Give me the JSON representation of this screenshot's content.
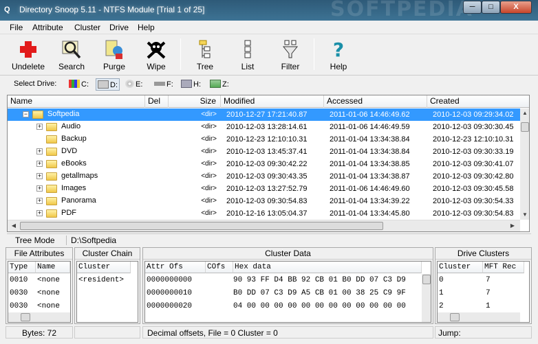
{
  "window": {
    "title": "Directory Snoop 5.11 - NTFS Module  [Trial 1 of 25]",
    "watermark": "SOFTPEDIA",
    "app_icon": "magnifier-icon",
    "min": "─",
    "max": "□",
    "close": "X"
  },
  "menu": [
    "File",
    "Attribute",
    "Cluster",
    "Drive",
    "Help"
  ],
  "toolbar": {
    "undelete": "Undelete",
    "search": "Search",
    "purge": "Purge",
    "wipe": "Wipe",
    "tree": "Tree",
    "list": "List",
    "filter": "Filter",
    "help": "Help"
  },
  "drives": {
    "label": "Select Drive:",
    "items": [
      "C:",
      "D:",
      "E:",
      "F:",
      "H:",
      "Z:"
    ]
  },
  "grid": {
    "columns": [
      "Name",
      "Del",
      "Size",
      "Modified",
      "Accessed",
      "Created"
    ],
    "rows": [
      {
        "name": "Softpedia",
        "size": "<dir>",
        "modified": "2010-12-27  17:21:40.87",
        "accessed": "2011-01-06  14:46:49.62",
        "created": "2010-12-03  09:29:34.02",
        "selected": true,
        "expand": "−"
      },
      {
        "name": "Audio",
        "size": "<dir>",
        "modified": "2010-12-03  13:28:14.61",
        "accessed": "2011-01-06  14:46:49.59",
        "created": "2010-12-03  09:30:30.45",
        "expand": "+"
      },
      {
        "name": "Backup",
        "size": "<dir>",
        "modified": "2010-12-23  12:10:10.31",
        "accessed": "2011-01-04  13:34:38.84",
        "created": "2010-12-23  12:10:10.31",
        "expand": ""
      },
      {
        "name": "DVD",
        "size": "<dir>",
        "modified": "2010-12-03  13:45:37.41",
        "accessed": "2011-01-04  13:34:38.84",
        "created": "2010-12-03  09:30:33.19",
        "expand": "+"
      },
      {
        "name": "eBooks",
        "size": "<dir>",
        "modified": "2010-12-03  09:30:42.22",
        "accessed": "2011-01-04  13:34:38.85",
        "created": "2010-12-03  09:30:41.07",
        "expand": "+"
      },
      {
        "name": "getallmaps",
        "size": "<dir>",
        "modified": "2010-12-03  09:30:43.35",
        "accessed": "2011-01-04  13:34:38.87",
        "created": "2010-12-03  09:30:42.80",
        "expand": "+"
      },
      {
        "name": "Images",
        "size": "<dir>",
        "modified": "2010-12-03  13:27:52.79",
        "accessed": "2011-01-06  14:46:49.60",
        "created": "2010-12-03  09:30:45.58",
        "expand": "+"
      },
      {
        "name": "Panorama",
        "size": "<dir>",
        "modified": "2010-12-03  09:30:54.83",
        "accessed": "2011-01-04  13:34:39.22",
        "created": "2010-12-03  09:30:54.33",
        "expand": "+"
      },
      {
        "name": "PDF",
        "size": "<dir>",
        "modified": "2010-12-16  13:05:04.37",
        "accessed": "2011-01-04  13:34:45.80",
        "created": "2010-12-03  09:30:54.83",
        "expand": "+"
      }
    ]
  },
  "status": {
    "mode": "Tree Mode",
    "path": "D:\\Softpedia"
  },
  "file_attributes": {
    "title": "File Attributes",
    "cols": [
      "Type",
      "Name"
    ],
    "rows": [
      [
        "0010",
        "<none"
      ],
      [
        "0030",
        "<none"
      ],
      [
        "0030",
        "<none"
      ]
    ],
    "footer": "Bytes: 72"
  },
  "cluster_chain": {
    "title": "Cluster Chain",
    "cols": [
      "Cluster"
    ],
    "rows": [
      "<resident>"
    ]
  },
  "cluster_data": {
    "title": "Cluster Data",
    "cols": [
      "Attr Ofs",
      "COfs",
      "Hex data"
    ],
    "rows": [
      [
        "0000000000",
        "",
        "90 93 FF D4 BB 92 CB 01 B0 DD 07 C3 D9"
      ],
      [
        "0000000010",
        "",
        "B0 DD 07 C3 D9 A5 CB 01 00 38 25 C9 9F"
      ],
      [
        "0000000020",
        "",
        "04 00 00 00 00 00 00 00 00 00 00 00 00"
      ]
    ],
    "footer": "Decimal offsets, File = 0     Cluster = 0"
  },
  "drive_clusters": {
    "title": "Drive Clusters",
    "cols": [
      "Cluster",
      "MFT Rec"
    ],
    "rows": [
      [
        "0",
        "7"
      ],
      [
        "1",
        "7"
      ],
      [
        "2",
        "1"
      ]
    ],
    "footer": "Jump:"
  }
}
